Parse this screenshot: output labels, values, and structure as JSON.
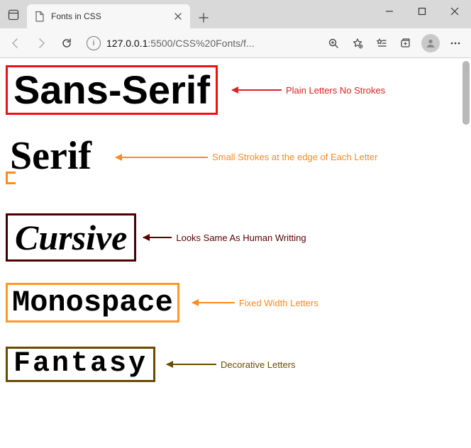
{
  "browser": {
    "tab_title": "Fonts in CSS",
    "url_display_prefix": "127.0.0.1",
    "url_display_suffix": ":5500/CSS%20Fonts/f...",
    "icons": {
      "tabs_panel": "tabs-panel-icon",
      "favicon": "document-icon",
      "close_tab": "close-icon",
      "new_tab": "plus-icon",
      "minimize": "minimize-icon",
      "maximize": "maximize-icon",
      "close_window": "close-icon",
      "back": "arrow-left-icon",
      "forward": "arrow-right-icon",
      "reload": "reload-icon",
      "site_info": "info-icon",
      "zoom": "zoom-icon",
      "favorite": "star-plus-icon",
      "favorites_bar": "star-list-icon",
      "collections": "collections-icon",
      "profile": "profile-icon",
      "menu": "dots-icon"
    }
  },
  "page": {
    "rows": [
      {
        "id": "sans",
        "sample": "Sans-Serif",
        "annotation": "Plain Letters No Strokes",
        "color": "#d22"
      },
      {
        "id": "serif",
        "sample": "Serif",
        "annotation": "Small Strokes at the edge of Each Letter",
        "color": "#ff8a1f"
      },
      {
        "id": "cursive",
        "sample": "Cursive",
        "annotation": "Looks Same As Human Writting",
        "color": "#5a0000"
      },
      {
        "id": "mono",
        "sample": "Monospace",
        "annotation": "Fixed Width Letters",
        "color": "#ff8a1f"
      },
      {
        "id": "fantasy",
        "sample": "Fantasy",
        "annotation": "Decorative Letters",
        "color": "#6b4a00"
      }
    ]
  }
}
